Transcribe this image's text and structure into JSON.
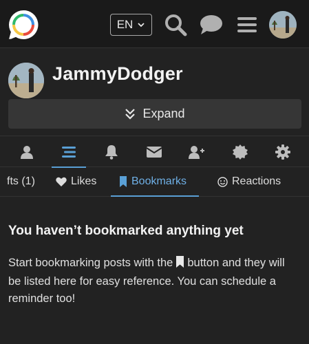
{
  "header": {
    "language": "EN",
    "icons": [
      "chat-bubble-logo",
      "search-icon",
      "messages-icon",
      "hamburger-menu-icon",
      "user-avatar"
    ]
  },
  "profile": {
    "username": "JammyDodger",
    "expand_label": "Expand"
  },
  "icon_tabs": [
    "user-icon",
    "activity-icon",
    "bell-icon",
    "envelope-icon",
    "user-plus-icon",
    "badge-icon",
    "gear-icon"
  ],
  "sub_tabs": {
    "drafts": "fts (1)",
    "likes": "Likes",
    "bookmarks": "Bookmarks",
    "reactions": "Reactions"
  },
  "empty_state": {
    "title": "You haven’t bookmarked anything yet",
    "body_part1": "Start bookmarking posts with the",
    "body_part2": "button and they will be listed here for easy reference. You can schedule a reminder too!"
  },
  "colors": {
    "background": "#222222",
    "header": "#1a1a1a",
    "accent": "#5aa0d6"
  }
}
